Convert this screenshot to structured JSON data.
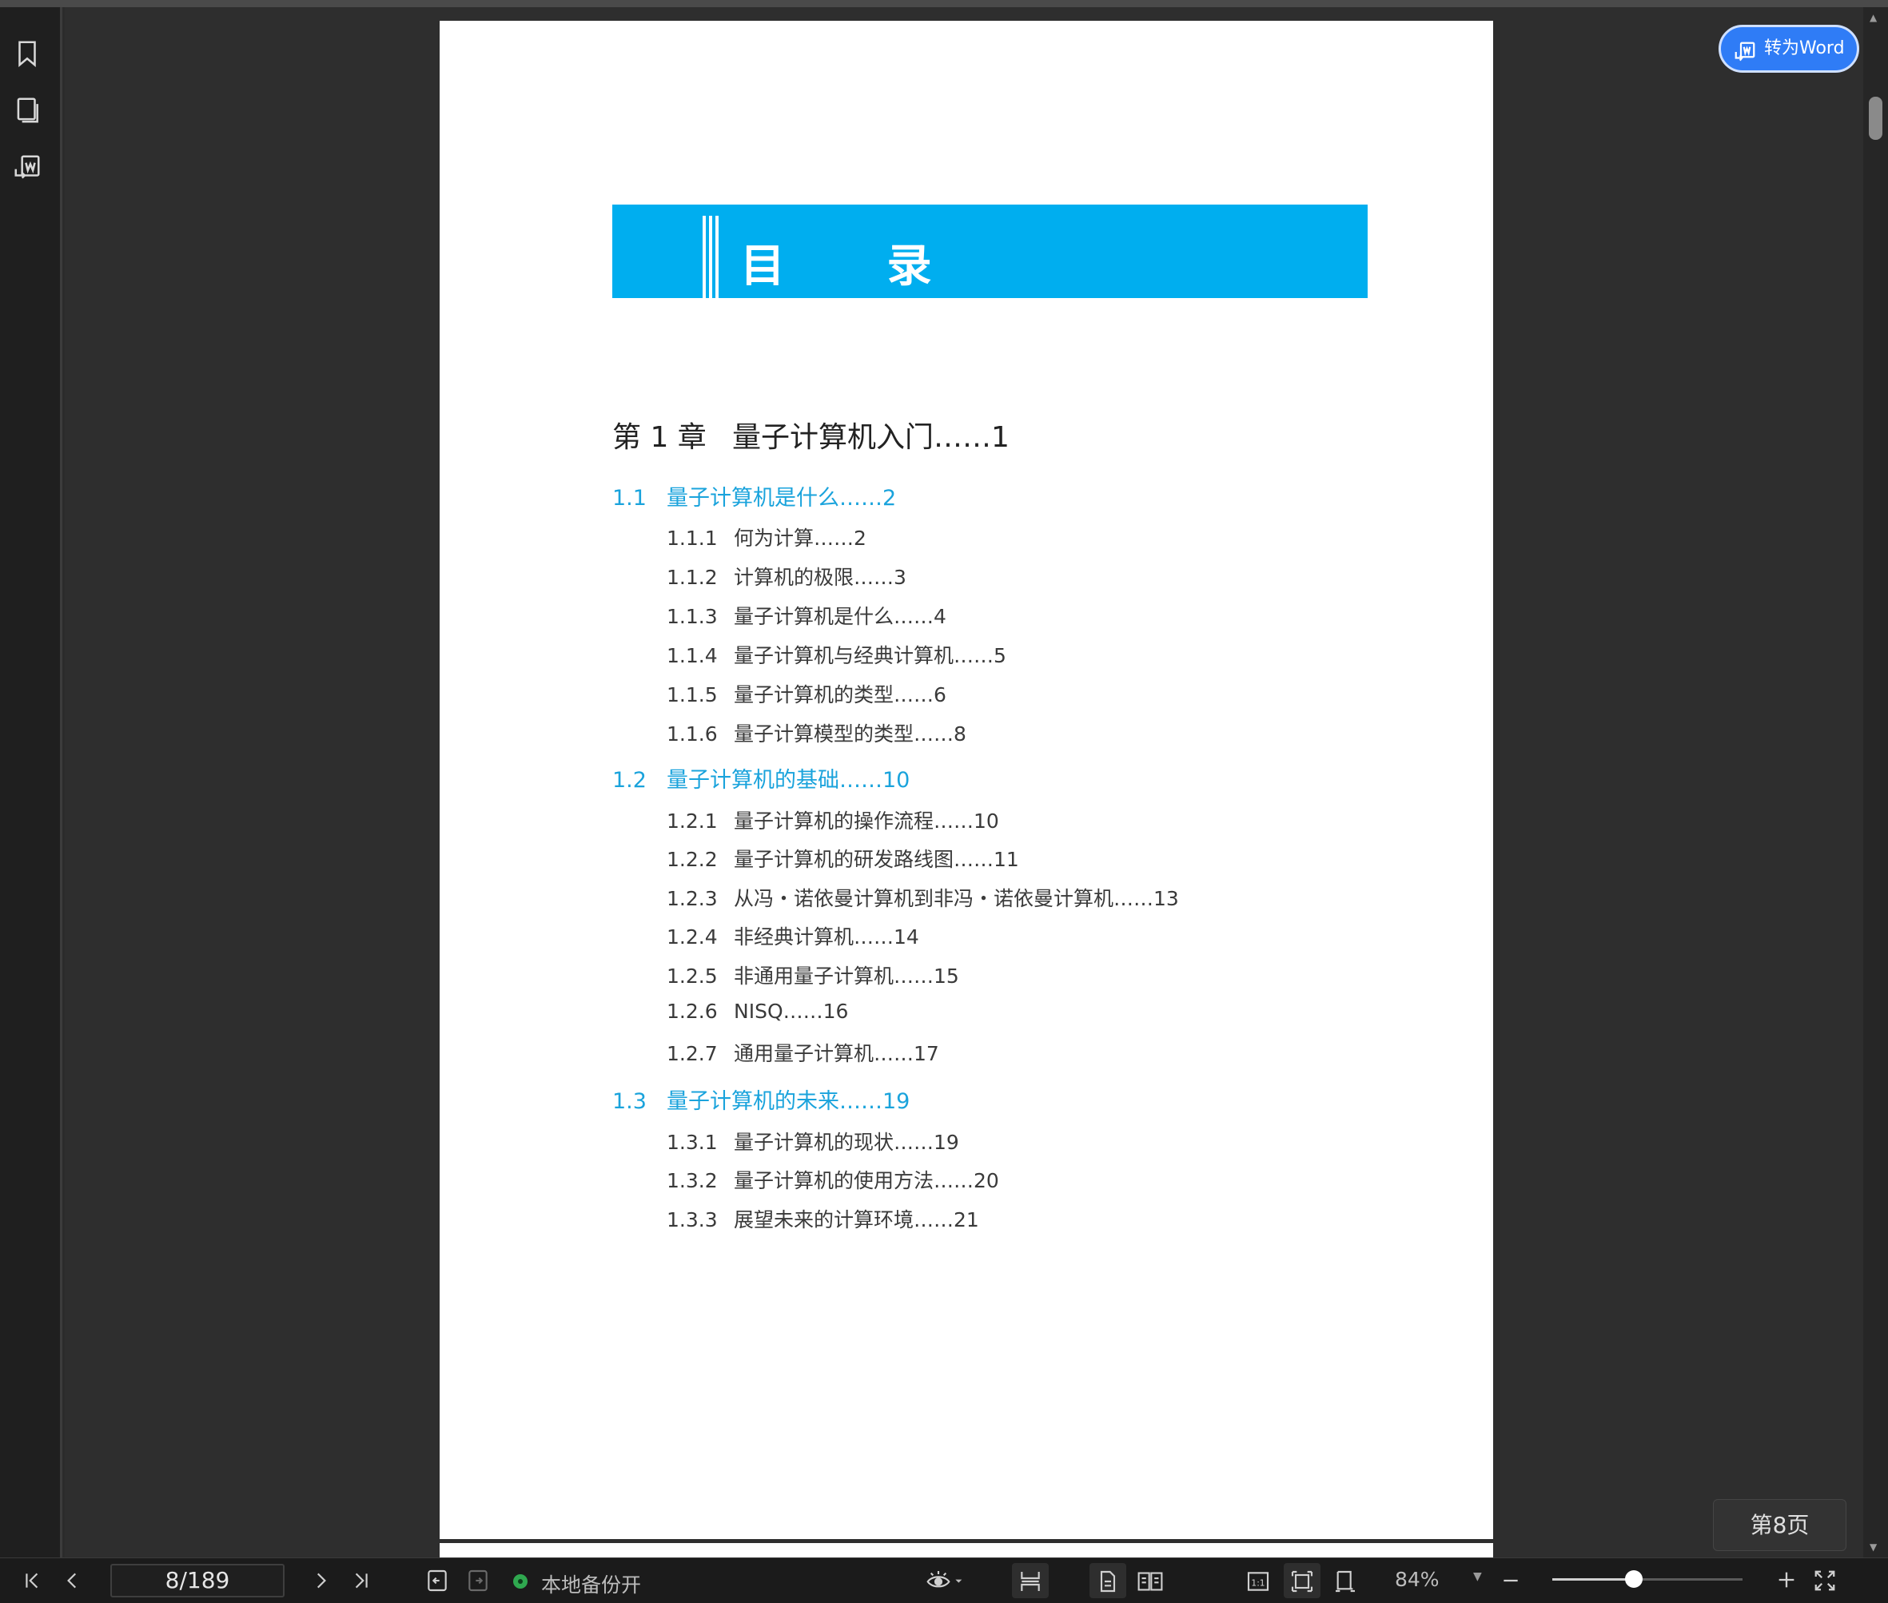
{
  "sidebar": {
    "icons": [
      "bookmark-icon",
      "thumbnail-icon",
      "convert-icon"
    ]
  },
  "document": {
    "toc_title": "目  录",
    "chapter": {
      "num": "第 1 章",
      "title": "量子计算机入门……1"
    },
    "sections": [
      {
        "num": "1.1",
        "title": "量子计算机是什么……2",
        "items": [
          {
            "num": "1.1.1",
            "title": "何为计算……2"
          },
          {
            "num": "1.1.2",
            "title": "计算机的极限……3"
          },
          {
            "num": "1.1.3",
            "title": "量子计算机是什么……4"
          },
          {
            "num": "1.1.4",
            "title": "量子计算机与经典计算机……5"
          },
          {
            "num": "1.1.5",
            "title": "量子计算机的类型……6"
          },
          {
            "num": "1.1.6",
            "title": "量子计算模型的类型……8"
          }
        ]
      },
      {
        "num": "1.2",
        "title": "量子计算机的基础……10",
        "items": [
          {
            "num": "1.2.1",
            "title": "量子计算机的操作流程……10"
          },
          {
            "num": "1.2.2",
            "title": "量子计算机的研发路线图……11"
          },
          {
            "num": "1.2.3",
            "title": "从冯・诺依曼计算机到非冯・诺依曼计算机……13"
          },
          {
            "num": "1.2.4",
            "title": "非经典计算机……14"
          },
          {
            "num": "1.2.5",
            "title": "非通用量子计算机……15"
          },
          {
            "num": "1.2.6",
            "title": "NISQ……16"
          },
          {
            "num": "1.2.7",
            "title": "通用量子计算机……17"
          }
        ]
      },
      {
        "num": "1.3",
        "title": "量子计算机的未来……19",
        "items": [
          {
            "num": "1.3.1",
            "title": "量子计算机的现状……19"
          },
          {
            "num": "1.3.2",
            "title": "量子计算机的使用方法……20"
          },
          {
            "num": "1.3.3",
            "title": "展望未来的计算环境……21"
          }
        ]
      }
    ]
  },
  "overlay": {
    "to_word_label": "转为Word",
    "page_indicator": "第8页"
  },
  "bottombar": {
    "page_input": "8/189",
    "backup_status": "本地备份开",
    "zoom": "84%",
    "zoom_level": 0.43
  },
  "colors": {
    "accent": "#00aeef",
    "section_text": "#1aa3dc",
    "button": "#2f7cf6"
  }
}
